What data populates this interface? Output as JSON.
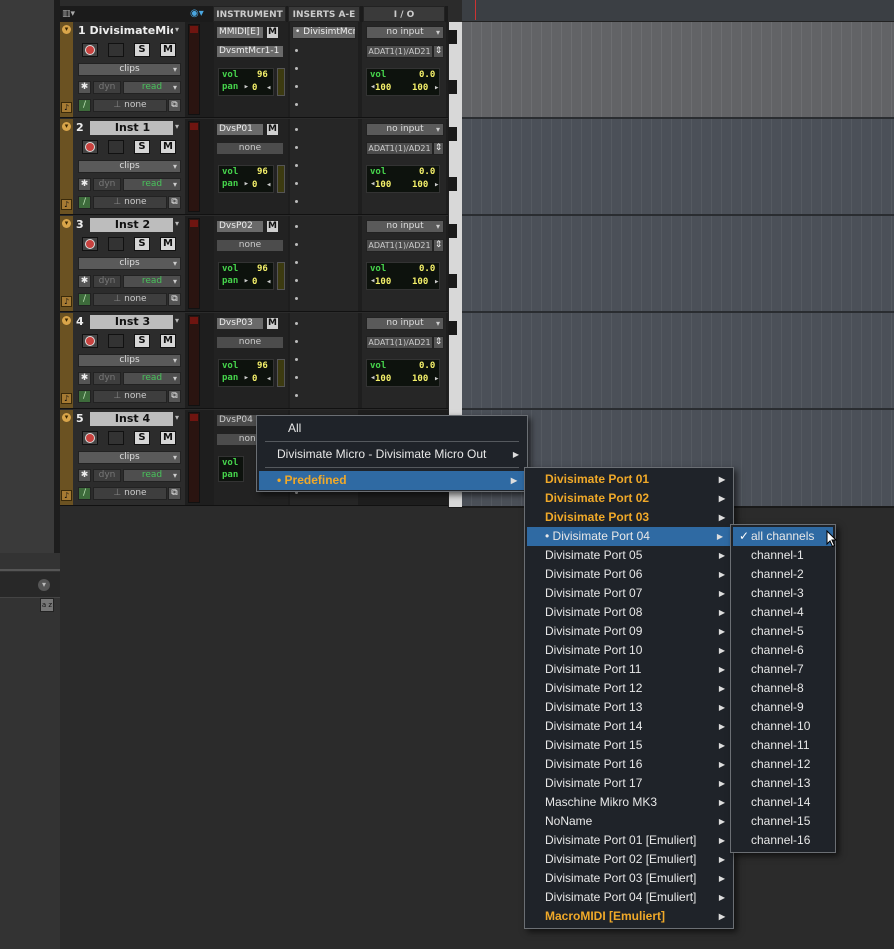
{
  "header": {
    "instrument": "INSTRUMENT",
    "inserts": "INSERTS A-E",
    "io": "I / O"
  },
  "tracks": [
    {
      "name": "1 DivisimateMicr",
      "clips": "clips",
      "dyn": "dyn",
      "read": "read",
      "none": "none",
      "inst_btn": "MMIDI[E]",
      "inst_sub": "DvsmtMcr1-1",
      "vol_label": "vol",
      "vol": "96",
      "pan_label": "pan",
      "pan": "0",
      "insert": "DivisimtMcr",
      "io_in": "no input",
      "io_out": "ADAT1(1)/AD21",
      "io_vol": "0.0",
      "io_l": "100",
      "io_r": "100"
    },
    {
      "name": "Inst 1",
      "num": "2",
      "clips": "clips",
      "dyn": "dyn",
      "read": "read",
      "none": "none",
      "inst_btn": "DvsP01",
      "inst_sub": "none",
      "vol_label": "vol",
      "vol": "96",
      "pan_label": "pan",
      "pan": "0",
      "io_in": "no input",
      "io_out": "ADAT1(1)/AD21",
      "io_vol": "0.0",
      "io_l": "100",
      "io_r": "100"
    },
    {
      "name": "Inst 2",
      "num": "3",
      "clips": "clips",
      "dyn": "dyn",
      "read": "read",
      "none": "none",
      "inst_btn": "DvsP02",
      "inst_sub": "none",
      "vol_label": "vol",
      "vol": "96",
      "pan_label": "pan",
      "pan": "0",
      "io_in": "no input",
      "io_out": "ADAT1(1)/AD21",
      "io_vol": "0.0",
      "io_l": "100",
      "io_r": "100"
    },
    {
      "name": "Inst 3",
      "num": "4",
      "clips": "clips",
      "dyn": "dyn",
      "read": "read",
      "none": "none",
      "inst_btn": "DvsP03",
      "inst_sub": "none",
      "vol_label": "vol",
      "vol": "96",
      "pan_label": "pan",
      "pan": "0",
      "io_in": "no input",
      "io_out": "ADAT1(1)/AD21",
      "io_vol": "0.0",
      "io_l": "100",
      "io_r": "100"
    },
    {
      "name": "Inst 4",
      "num": "5",
      "clips": "clips",
      "dyn": "dyn",
      "read": "read",
      "none": "none",
      "inst_btn": "DvsP04",
      "inst_sub": "none",
      "vol_label": "vol",
      "pan_label": "pan"
    }
  ],
  "menu1": {
    "items": [
      "All",
      "Divisimate Micro - Divisimate Micro Out",
      "Predefined"
    ]
  },
  "menu2": {
    "items": [
      "Divisimate Port 01",
      "Divisimate Port 02",
      "Divisimate Port 03",
      "Divisimate Port 04",
      "Divisimate Port 05",
      "Divisimate Port 06",
      "Divisimate Port 07",
      "Divisimate Port 08",
      "Divisimate Port 09",
      "Divisimate Port 10",
      "Divisimate Port 11",
      "Divisimate Port 12",
      "Divisimate Port 13",
      "Divisimate Port 14",
      "Divisimate Port 15",
      "Divisimate Port 16",
      "Divisimate Port 17",
      "Maschine Mikro MK3",
      "NoName",
      "Divisimate Port 01 [Emuliert]",
      "Divisimate Port 02 [Emuliert]",
      "Divisimate Port 03 [Emuliert]",
      "Divisimate Port 04 [Emuliert]",
      "MacroMIDI [Emuliert]"
    ]
  },
  "menu3": {
    "items": [
      "all channels",
      "channel-1",
      "channel-2",
      "channel-3",
      "channel-4",
      "channel-5",
      "channel-6",
      "channel-7",
      "channel-8",
      "channel-9",
      "channel-10",
      "channel-11",
      "channel-12",
      "channel-13",
      "channel-14",
      "channel-15",
      "channel-16"
    ]
  },
  "colors": {
    "menu_highlight": "#2f6aa3",
    "orange_text": "#f0a929",
    "lcd_green": "#46d44c",
    "read_green": "#49c35b"
  }
}
